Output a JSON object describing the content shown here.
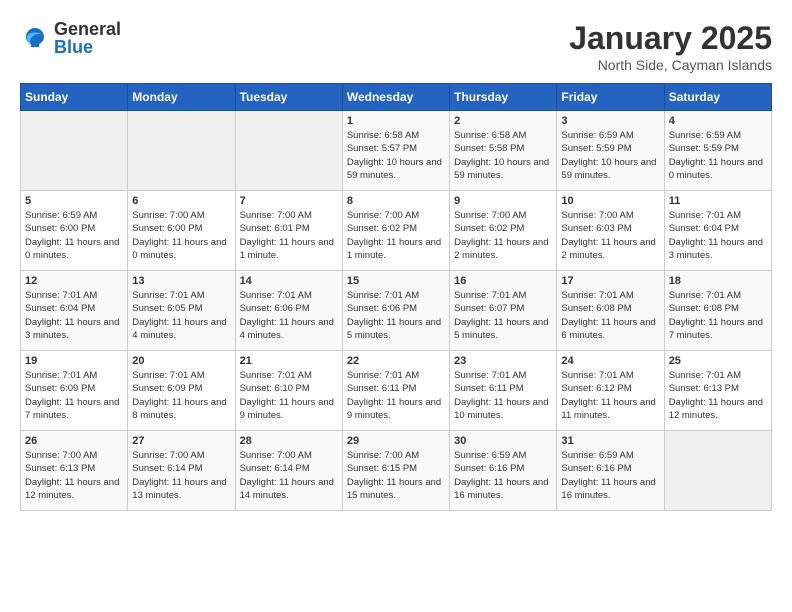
{
  "logo": {
    "general": "General",
    "blue": "Blue"
  },
  "title": "January 2025",
  "subtitle": "North Side, Cayman Islands",
  "days_of_week": [
    "Sunday",
    "Monday",
    "Tuesday",
    "Wednesday",
    "Thursday",
    "Friday",
    "Saturday"
  ],
  "weeks": [
    [
      {
        "day": "",
        "empty": true
      },
      {
        "day": "",
        "empty": true
      },
      {
        "day": "",
        "empty": true
      },
      {
        "day": "1",
        "sunrise": "6:58 AM",
        "sunset": "5:57 PM",
        "daylight": "10 hours and 59 minutes."
      },
      {
        "day": "2",
        "sunrise": "6:58 AM",
        "sunset": "5:58 PM",
        "daylight": "10 hours and 59 minutes."
      },
      {
        "day": "3",
        "sunrise": "6:59 AM",
        "sunset": "5:59 PM",
        "daylight": "10 hours and 59 minutes."
      },
      {
        "day": "4",
        "sunrise": "6:59 AM",
        "sunset": "5:59 PM",
        "daylight": "11 hours and 0 minutes."
      }
    ],
    [
      {
        "day": "5",
        "sunrise": "6:59 AM",
        "sunset": "6:00 PM",
        "daylight": "11 hours and 0 minutes."
      },
      {
        "day": "6",
        "sunrise": "7:00 AM",
        "sunset": "6:00 PM",
        "daylight": "11 hours and 0 minutes."
      },
      {
        "day": "7",
        "sunrise": "7:00 AM",
        "sunset": "6:01 PM",
        "daylight": "11 hours and 1 minute."
      },
      {
        "day": "8",
        "sunrise": "7:00 AM",
        "sunset": "6:02 PM",
        "daylight": "11 hours and 1 minute."
      },
      {
        "day": "9",
        "sunrise": "7:00 AM",
        "sunset": "6:02 PM",
        "daylight": "11 hours and 2 minutes."
      },
      {
        "day": "10",
        "sunrise": "7:00 AM",
        "sunset": "6:03 PM",
        "daylight": "11 hours and 2 minutes."
      },
      {
        "day": "11",
        "sunrise": "7:01 AM",
        "sunset": "6:04 PM",
        "daylight": "11 hours and 3 minutes."
      }
    ],
    [
      {
        "day": "12",
        "sunrise": "7:01 AM",
        "sunset": "6:04 PM",
        "daylight": "11 hours and 3 minutes."
      },
      {
        "day": "13",
        "sunrise": "7:01 AM",
        "sunset": "6:05 PM",
        "daylight": "11 hours and 4 minutes."
      },
      {
        "day": "14",
        "sunrise": "7:01 AM",
        "sunset": "6:06 PM",
        "daylight": "11 hours and 4 minutes."
      },
      {
        "day": "15",
        "sunrise": "7:01 AM",
        "sunset": "6:06 PM",
        "daylight": "11 hours and 5 minutes."
      },
      {
        "day": "16",
        "sunrise": "7:01 AM",
        "sunset": "6:07 PM",
        "daylight": "11 hours and 5 minutes."
      },
      {
        "day": "17",
        "sunrise": "7:01 AM",
        "sunset": "6:08 PM",
        "daylight": "11 hours and 6 minutes."
      },
      {
        "day": "18",
        "sunrise": "7:01 AM",
        "sunset": "6:08 PM",
        "daylight": "11 hours and 7 minutes."
      }
    ],
    [
      {
        "day": "19",
        "sunrise": "7:01 AM",
        "sunset": "6:09 PM",
        "daylight": "11 hours and 7 minutes."
      },
      {
        "day": "20",
        "sunrise": "7:01 AM",
        "sunset": "6:09 PM",
        "daylight": "11 hours and 8 minutes."
      },
      {
        "day": "21",
        "sunrise": "7:01 AM",
        "sunset": "6:10 PM",
        "daylight": "11 hours and 9 minutes."
      },
      {
        "day": "22",
        "sunrise": "7:01 AM",
        "sunset": "6:11 PM",
        "daylight": "11 hours and 9 minutes."
      },
      {
        "day": "23",
        "sunrise": "7:01 AM",
        "sunset": "6:11 PM",
        "daylight": "11 hours and 10 minutes."
      },
      {
        "day": "24",
        "sunrise": "7:01 AM",
        "sunset": "6:12 PM",
        "daylight": "11 hours and 11 minutes."
      },
      {
        "day": "25",
        "sunrise": "7:01 AM",
        "sunset": "6:13 PM",
        "daylight": "11 hours and 12 minutes."
      }
    ],
    [
      {
        "day": "26",
        "sunrise": "7:00 AM",
        "sunset": "6:13 PM",
        "daylight": "11 hours and 12 minutes."
      },
      {
        "day": "27",
        "sunrise": "7:00 AM",
        "sunset": "6:14 PM",
        "daylight": "11 hours and 13 minutes."
      },
      {
        "day": "28",
        "sunrise": "7:00 AM",
        "sunset": "6:14 PM",
        "daylight": "11 hours and 14 minutes."
      },
      {
        "day": "29",
        "sunrise": "7:00 AM",
        "sunset": "6:15 PM",
        "daylight": "11 hours and 15 minutes."
      },
      {
        "day": "30",
        "sunrise": "6:59 AM",
        "sunset": "6:16 PM",
        "daylight": "11 hours and 16 minutes."
      },
      {
        "day": "31",
        "sunrise": "6:59 AM",
        "sunset": "6:16 PM",
        "daylight": "11 hours and 16 minutes."
      },
      {
        "day": "",
        "empty": true
      }
    ]
  ],
  "labels": {
    "sunrise": "Sunrise:",
    "sunset": "Sunset:",
    "daylight": "Daylight:"
  }
}
